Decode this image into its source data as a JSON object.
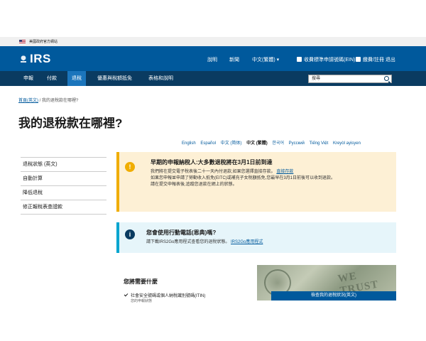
{
  "gov_banner": {
    "text": "美國政府官方網站"
  },
  "header": {
    "logo_text": "IRS",
    "links": [
      "說明",
      "新聞",
      "中文(繁體)",
      "收費標準申請號碼(EIN)",
      "繳費/註冊 退出"
    ],
    "language_value": "中文(繁體)"
  },
  "nav": {
    "items": [
      "申報",
      "付款",
      "退稅",
      "優惠與稅額抵免",
      "表格和說明"
    ],
    "active_index": 2,
    "search_placeholder": "搜尋"
  },
  "breadcrumb": {
    "home": "首頁(英文)",
    "separator": "/",
    "current": "我的退稅款在哪裡?"
  },
  "page_title": "我的退稅款在哪裡?",
  "languages": {
    "items": [
      "English",
      "Español",
      "中文 (简体)",
      "中文 (繁體)",
      "한국어",
      "Русский",
      "Tiếng Việt",
      "Kreyòl ayisyen"
    ],
    "current_index": 3
  },
  "sidebar": {
    "items": [
      "退稅狀態 (英文)",
      "自動計算",
      "降低退稅",
      "修正報稅表查證款"
    ]
  },
  "alert_warning": {
    "title": "早期的申報納稅人:大多數退稅將在3月1日前到達",
    "lines": [
      "我們將在提交電子稅表後二十一天內付退款,如果您選擇直接存款。",
      "如果您申報並申請了勞動收入抵免(EITC)或補充子女稅額抵免,您最早在3月1日前後可以收到退款。",
      "請在提交申報表後,追蹤您退款在網上的狀態。"
    ],
    "link_text": "直接存款"
  },
  "alert_info": {
    "title": "您會使用行動電話(恩典)嗎?",
    "line": "請下載IRS2Go應用程式查看您的退稅狀態。",
    "link_text": "IRS2Go應用程式"
  },
  "need_section": {
    "title": "您將需要什麼",
    "item": "社會安全號碼或個人納稅識別號碼(ITIN)",
    "sub": "您的申報狀態"
  },
  "money_image": {
    "watermark": "WE TRUST"
  },
  "cta_button": "檢查我的退稅狀況(英文)"
}
